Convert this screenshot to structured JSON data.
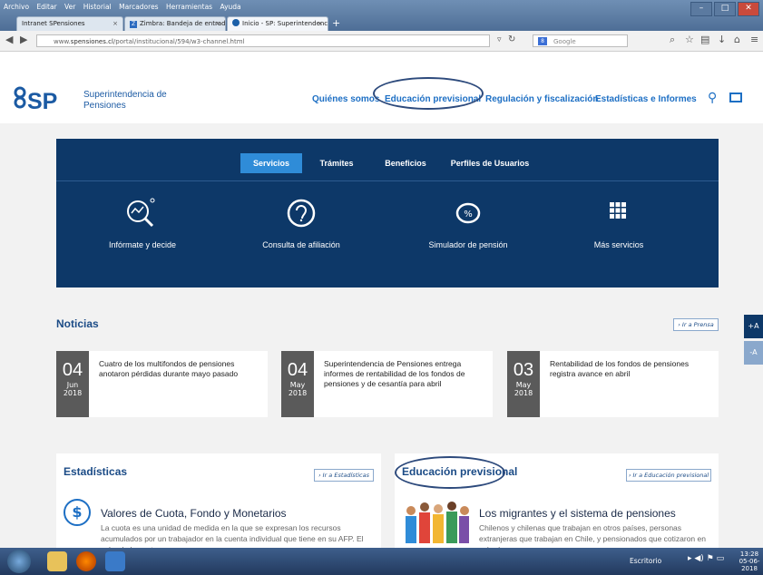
{
  "browser": {
    "menu": [
      "Archivo",
      "Editar",
      "Ver",
      "Historial",
      "Marcadores",
      "Herramientas",
      "Ayuda"
    ],
    "tabs": [
      {
        "label": "Intranet SPensiones"
      },
      {
        "label": "Zimbra: Bandeja de entrad..."
      },
      {
        "label": "Inicio - SP: Superintendenc..."
      }
    ],
    "url_prefix": "www.",
    "url_domain": "spensiones.cl",
    "url_path": "/portal/institucional/594/w3-channel.html",
    "search_placeholder": "Google"
  },
  "site": {
    "logo_mark": "SP",
    "logo_line1": "Superintendencia de",
    "logo_line2": "Pensiones",
    "nav": [
      "Quiénes somos",
      "Educación previsional",
      "Regulación y fiscalización",
      "Estadísticas e Informes"
    ]
  },
  "services": {
    "tabs": [
      "Servicios",
      "Trámites",
      "Beneficios",
      "Perfiles de Usuarios"
    ],
    "items": [
      {
        "label": "Infórmate y decide"
      },
      {
        "label": "Consulta de afiliación"
      },
      {
        "label": "Simulador de pensión"
      },
      {
        "label": "Más servicios"
      }
    ]
  },
  "news": {
    "heading": "Noticias",
    "link": "› Ir a Prensa",
    "items": [
      {
        "day": "04",
        "month": "Jun",
        "year": "2018",
        "text": "Cuatro de los multifondos de pensiones anotaron pérdidas durante mayo pasado"
      },
      {
        "day": "04",
        "month": "May",
        "year": "2018",
        "text": "Superintendencia de Pensiones entrega informes de rentabilidad de los fondos de pensiones y de cesantía para abril"
      },
      {
        "day": "03",
        "month": "May",
        "year": "2018",
        "text": "Rentabilidad de los fondos de pensiones registra avance en abril"
      }
    ]
  },
  "stats": {
    "heading": "Estadísticas",
    "link": "› Ir a Estadísticas",
    "title": "Valores de Cuota, Fondo y Monetarios",
    "body": "La cuota es una unidad de medida en la que se expresan los recursos acumulados por un trabajador en la cuenta individual que tiene en su AFP. El valor de la cuota"
  },
  "education": {
    "heading": "Educación previsional",
    "link": "› Ir a Educación previsional",
    "title": "Los migrantes y el sistema de pensiones",
    "body": "Chilenos y chilenas que trabajan en otros países, personas extranjeras que trabajan en Chile, y pensionados que cotizaron en más de un"
  },
  "accessibility": {
    "plus": "+A",
    "minus": "-A"
  },
  "taskbar": {
    "desktop": "Escritorio",
    "time": "13:28",
    "date": "05-06-2018"
  }
}
